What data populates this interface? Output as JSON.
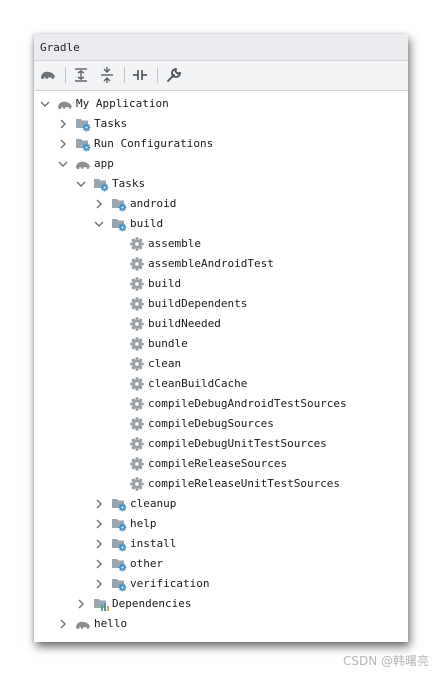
{
  "panel": {
    "title": "Gradle"
  },
  "toolbar": {
    "buttons": [
      {
        "icon": "elephant-icon"
      },
      {
        "icon": "expand-all-icon"
      },
      {
        "icon": "collapse-all-icon"
      },
      {
        "icon": "toggle-offline-icon"
      },
      {
        "icon": "wrench-icon"
      }
    ]
  },
  "tree": [
    {
      "label": "My Application",
      "level": 0,
      "icon": "gradle-elephant-icon",
      "state": "expanded"
    },
    {
      "label": "Tasks",
      "level": 1,
      "icon": "tasks-folder-icon",
      "state": "collapsed"
    },
    {
      "label": "Run Configurations",
      "level": 1,
      "icon": "tasks-folder-icon",
      "state": "collapsed"
    },
    {
      "label": "app",
      "level": 1,
      "icon": "gradle-elephant-icon",
      "state": "expanded"
    },
    {
      "label": "Tasks",
      "level": 2,
      "icon": "tasks-folder-icon",
      "state": "expanded"
    },
    {
      "label": "android",
      "level": 3,
      "icon": "tasks-folder-icon",
      "state": "collapsed"
    },
    {
      "label": "build",
      "level": 3,
      "icon": "tasks-folder-icon",
      "state": "expanded"
    },
    {
      "label": "assemble",
      "level": 4,
      "icon": "gear-icon",
      "state": "leaf"
    },
    {
      "label": "assembleAndroidTest",
      "level": 4,
      "icon": "gear-icon",
      "state": "leaf"
    },
    {
      "label": "build",
      "level": 4,
      "icon": "gear-icon",
      "state": "leaf"
    },
    {
      "label": "buildDependents",
      "level": 4,
      "icon": "gear-icon",
      "state": "leaf"
    },
    {
      "label": "buildNeeded",
      "level": 4,
      "icon": "gear-icon",
      "state": "leaf"
    },
    {
      "label": "bundle",
      "level": 4,
      "icon": "gear-icon",
      "state": "leaf"
    },
    {
      "label": "clean",
      "level": 4,
      "icon": "gear-icon",
      "state": "leaf"
    },
    {
      "label": "cleanBuildCache",
      "level": 4,
      "icon": "gear-icon",
      "state": "leaf"
    },
    {
      "label": "compileDebugAndroidTestSources",
      "level": 4,
      "icon": "gear-icon",
      "state": "leaf"
    },
    {
      "label": "compileDebugSources",
      "level": 4,
      "icon": "gear-icon",
      "state": "leaf"
    },
    {
      "label": "compileDebugUnitTestSources",
      "level": 4,
      "icon": "gear-icon",
      "state": "leaf"
    },
    {
      "label": "compileReleaseSources",
      "level": 4,
      "icon": "gear-icon",
      "state": "leaf"
    },
    {
      "label": "compileReleaseUnitTestSources",
      "level": 4,
      "icon": "gear-icon",
      "state": "leaf"
    },
    {
      "label": "cleanup",
      "level": 3,
      "icon": "tasks-folder-icon",
      "state": "collapsed"
    },
    {
      "label": "help",
      "level": 3,
      "icon": "tasks-folder-icon",
      "state": "collapsed"
    },
    {
      "label": "install",
      "level": 3,
      "icon": "tasks-folder-icon",
      "state": "collapsed"
    },
    {
      "label": "other",
      "level": 3,
      "icon": "tasks-folder-icon",
      "state": "collapsed"
    },
    {
      "label": "verification",
      "level": 3,
      "icon": "tasks-folder-icon",
      "state": "collapsed"
    },
    {
      "label": "Dependencies",
      "level": 2,
      "icon": "dependencies-folder-icon",
      "state": "collapsed"
    },
    {
      "label": "hello",
      "level": 1,
      "icon": "gradle-elephant-icon",
      "state": "collapsed"
    }
  ],
  "watermark": "CSDN @韩曙亮",
  "colors": {
    "gear": "#9aa0a6",
    "folder": "#9aa7b0",
    "badge": "#3d8fd1",
    "elephant": "#8a8f94"
  }
}
